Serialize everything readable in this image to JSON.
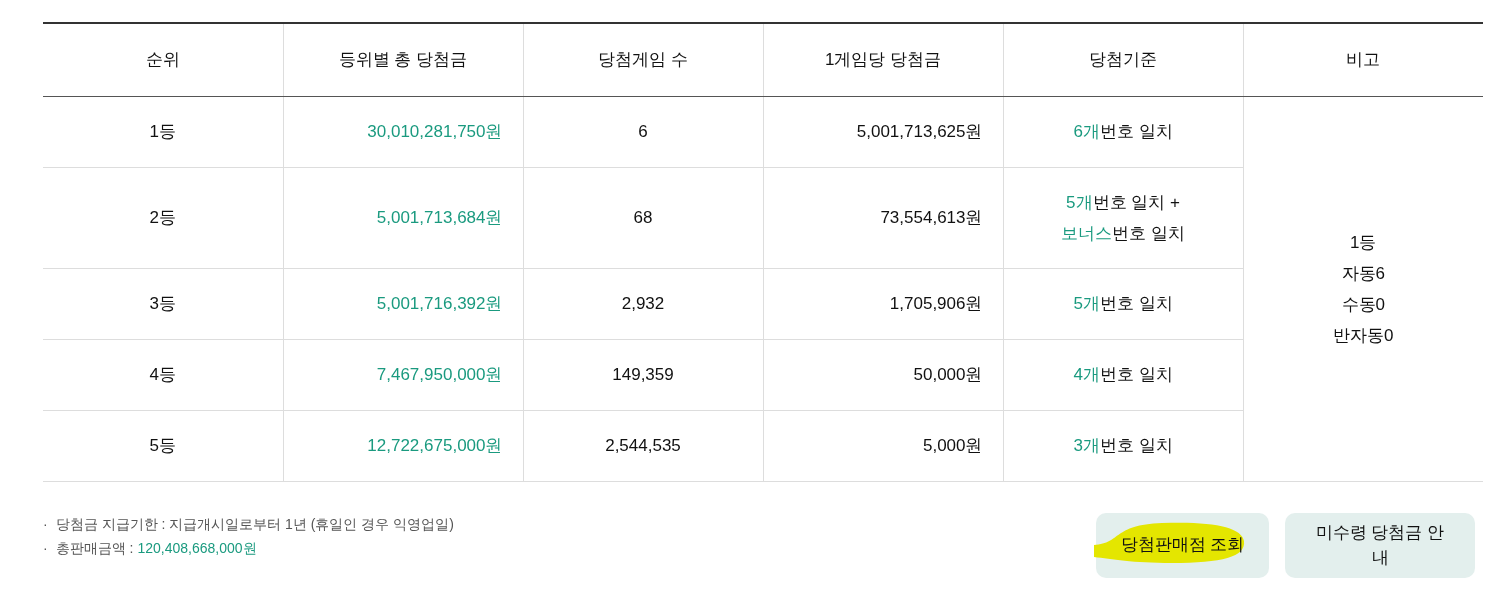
{
  "table": {
    "columns": [
      "순위",
      "등위별 총 당첨금",
      "당첨게임 수",
      "1게임당 당첨금",
      "당첨기준",
      "비고"
    ],
    "rows": [
      {
        "rank": "1등",
        "total": "30,010,281,750원",
        "games": "6",
        "per_game": "5,001,713,625원",
        "criteria": [
          {
            "count": "6개",
            "text": "번호 일치"
          }
        ]
      },
      {
        "rank": "2등",
        "total": "5,001,713,684원",
        "games": "68",
        "per_game": "73,554,613원",
        "criteria": [
          {
            "count": "5개",
            "text": "번호 일치 +"
          },
          {
            "count": "보너스",
            "text": "번호 일치"
          }
        ]
      },
      {
        "rank": "3등",
        "total": "5,001,716,392원",
        "games": "2,932",
        "per_game": "1,705,906원",
        "criteria": [
          {
            "count": "5개",
            "text": "번호 일치"
          }
        ]
      },
      {
        "rank": "4등",
        "total": "7,467,950,000원",
        "games": "149,359",
        "per_game": "50,000원",
        "criteria": [
          {
            "count": "4개",
            "text": "번호 일치"
          }
        ]
      },
      {
        "rank": "5등",
        "total": "12,722,675,000원",
        "games": "2,544,535",
        "per_game": "5,000원",
        "criteria": [
          {
            "count": "3개",
            "text": "번호 일치"
          }
        ]
      }
    ],
    "remarks": [
      "1등",
      "자동6",
      "수동0",
      "반자동0"
    ]
  },
  "notes": [
    {
      "bullet": "·",
      "label": "당첨금 지급기한 : 지급개시일로부터 1년 (휴일인 경우 익영업일)"
    },
    {
      "bullet": "·",
      "label": "총판매금액 :",
      "value": "120,408,668,000원"
    }
  ],
  "buttons": [
    {
      "label": "당첨판매점 조회",
      "highlighted": true
    },
    {
      "label": "미수령 당첨금 안내",
      "highlighted": false
    }
  ]
}
